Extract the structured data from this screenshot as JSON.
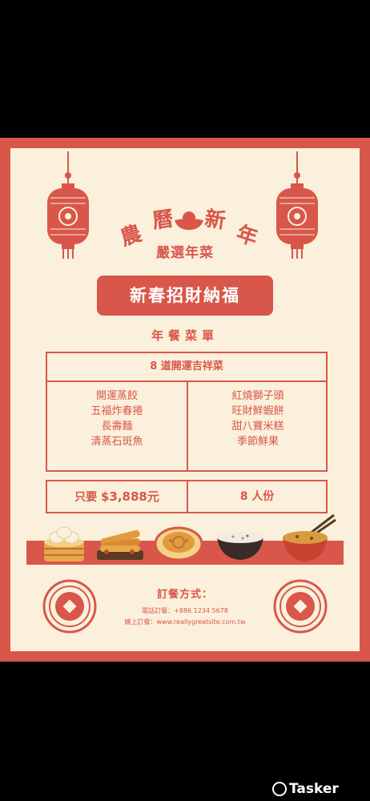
{
  "poster": {
    "title_chars": [
      "農",
      "曆",
      "新",
      "年"
    ],
    "subtitle": "嚴選年菜",
    "banner": "新春招財納福",
    "menu_label": "年餐菜單",
    "dishes_header": "8 道開運吉祥菜",
    "dishes_left": [
      "開運蒸餃",
      "五福炸春捲",
      "長壽麵",
      "清蒸石斑魚"
    ],
    "dishes_right": [
      "紅燒獅子頭",
      "旺財鮮蝦餅",
      "甜八寶米糕",
      "季節鮮果"
    ],
    "price_prefix": "只要",
    "price_amount": "$3,888元",
    "servings": "8 人份",
    "order_title": "訂餐方式：",
    "phone_line": "電話訂餐：+886 1234 5678",
    "web_line": "線上訂餐：www.reallygreatsite.com.tw"
  },
  "colors": {
    "accent": "#d8574a",
    "background": "#fbf0dc",
    "outer": "#000000"
  },
  "watermark": "Tasker"
}
